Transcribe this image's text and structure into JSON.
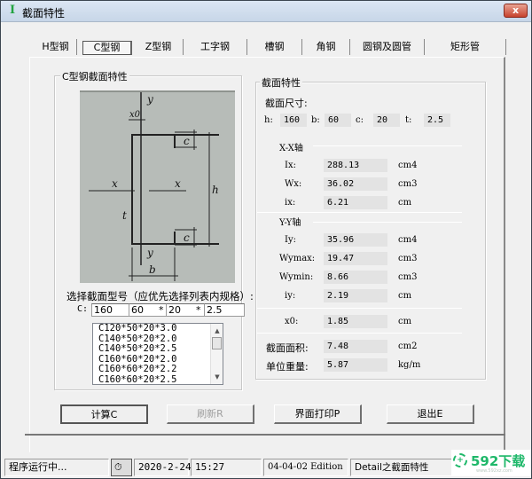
{
  "window": {
    "title": "截面特性",
    "app_icon": "I-beam-icon",
    "close_label": "x"
  },
  "tabs": [
    {
      "label": "H型钢",
      "active": false
    },
    {
      "label": "C型钢",
      "active": true
    },
    {
      "label": "Z型钢",
      "active": false
    },
    {
      "label": "工字钢",
      "active": false
    },
    {
      "label": "槽钢",
      "active": false
    },
    {
      "label": "角钢",
      "active": false
    },
    {
      "label": "圆钢及圆管",
      "active": false
    },
    {
      "label": "矩形管",
      "active": false
    }
  ],
  "left_group": {
    "title": "C型钢截面特性",
    "diagram_labels": {
      "y_top": "y",
      "y_bottom": "y",
      "x_left": "x",
      "x_right": "x",
      "x0": "x0",
      "c_top": "c",
      "c_bottom": "c",
      "h": "h",
      "t": "t",
      "b": "b"
    },
    "select_label": "选择截面型号（应优先选择列表内规格）:",
    "prefix": "C:",
    "separator": "*",
    "inputs": {
      "h": "160",
      "b": "60",
      "c": "20",
      "t": "2.5"
    },
    "list_items": [
      "C120*50*20*3.0",
      "C140*50*20*2.0",
      "C140*50*20*2.5",
      "C160*60*20*2.0",
      "C160*60*20*2.2",
      "C160*60*20*2.5"
    ]
  },
  "right_group": {
    "title": "截面特性",
    "size_title": "截面尺寸:",
    "sizes": [
      {
        "label": "h:",
        "value": "160"
      },
      {
        "label": "b:",
        "value": "60"
      },
      {
        "label": "c:",
        "value": "20"
      },
      {
        "label": "t:",
        "value": "2.5"
      }
    ],
    "xx_title": "X-X轴",
    "xx": [
      {
        "label": "Ix:",
        "value": "288.13",
        "unit": "cm4"
      },
      {
        "label": "Wx:",
        "value": "36.02",
        "unit": "cm3"
      },
      {
        "label": "ix:",
        "value": "6.21",
        "unit": "cm"
      }
    ],
    "yy_title": "Y-Y轴",
    "yy": [
      {
        "label": "Iy:",
        "value": "35.96",
        "unit": "cm4"
      },
      {
        "label": "Wymax:",
        "value": "19.47",
        "unit": "cm3"
      },
      {
        "label": "Wymin:",
        "value": "8.66",
        "unit": "cm3"
      },
      {
        "label": "iy:",
        "value": "2.19",
        "unit": "cm"
      }
    ],
    "x0": {
      "label": "x0:",
      "value": "1.85",
      "unit": "cm"
    },
    "area": {
      "label": "截面面积:",
      "value": "7.48",
      "unit": "cm2"
    },
    "weight": {
      "label": "单位重量:",
      "value": "5.87",
      "unit": "kg/m"
    }
  },
  "buttons": {
    "calc": "计算C",
    "refresh": "刷新R",
    "print": "界面打印P",
    "exit": "退出E"
  },
  "statusbar": {
    "status": "程序运行中...",
    "clock_icon": "stopwatch-icon",
    "date": "2020-2-24",
    "time": "15:27",
    "edition": "04-04-02 Edition",
    "module": "Detail之截面特性"
  },
  "watermark": {
    "text": "592下载",
    "sub": "www.592xz.com"
  }
}
